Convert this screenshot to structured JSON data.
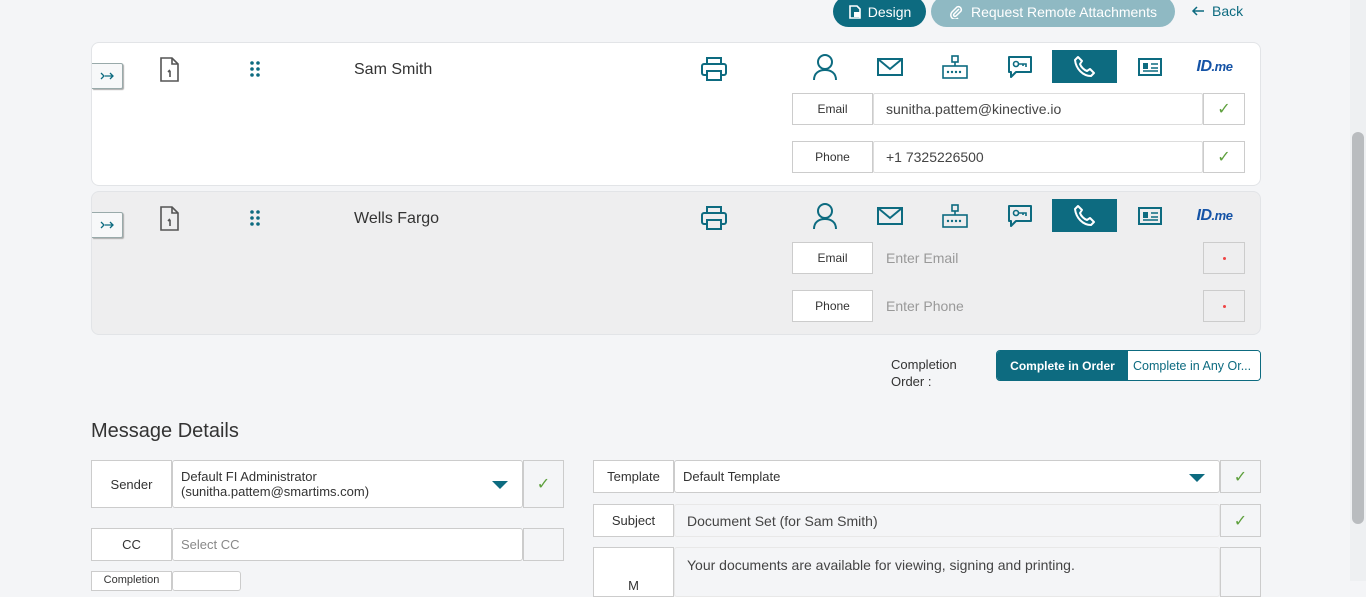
{
  "toolbar": {
    "design_label": "Design",
    "remote_label": "Request Remote Attachments",
    "back_label": "Back"
  },
  "recipients": [
    {
      "name": "Sam Smith",
      "email_label": "Email",
      "email_value": "sunitha.pattem@kinective.io",
      "phone_label": "Phone",
      "phone_value": "+1 7325226500"
    },
    {
      "name": "Wells Fargo",
      "email_label": "Email",
      "email_placeholder": "Enter Email",
      "phone_label": "Phone",
      "phone_placeholder": "Enter Phone"
    }
  ],
  "idme": {
    "id": "ID",
    "me": ".me"
  },
  "completion": {
    "label": "Completion Order :",
    "in_order": "Complete in Order",
    "any_order": "Complete in Any Or..."
  },
  "message": {
    "title": "Message Details",
    "sender_label": "Sender",
    "sender_value_line1": "Default FI Administrator",
    "sender_value_line2": "(sunitha.pattem@smartims.com)",
    "cc_label": "CC",
    "cc_placeholder": "Select CC",
    "completion_label": "Completion",
    "template_label": "Template",
    "template_value": "Default Template",
    "subject_label": "Subject",
    "subject_value": "Document Set (for Sam Smith)",
    "message_label": "M",
    "message_value": "Your documents are available for viewing, signing and printing."
  },
  "colors": {
    "accent": "#0d6b80",
    "success": "#5ea03d",
    "idme": "#1553a6"
  }
}
